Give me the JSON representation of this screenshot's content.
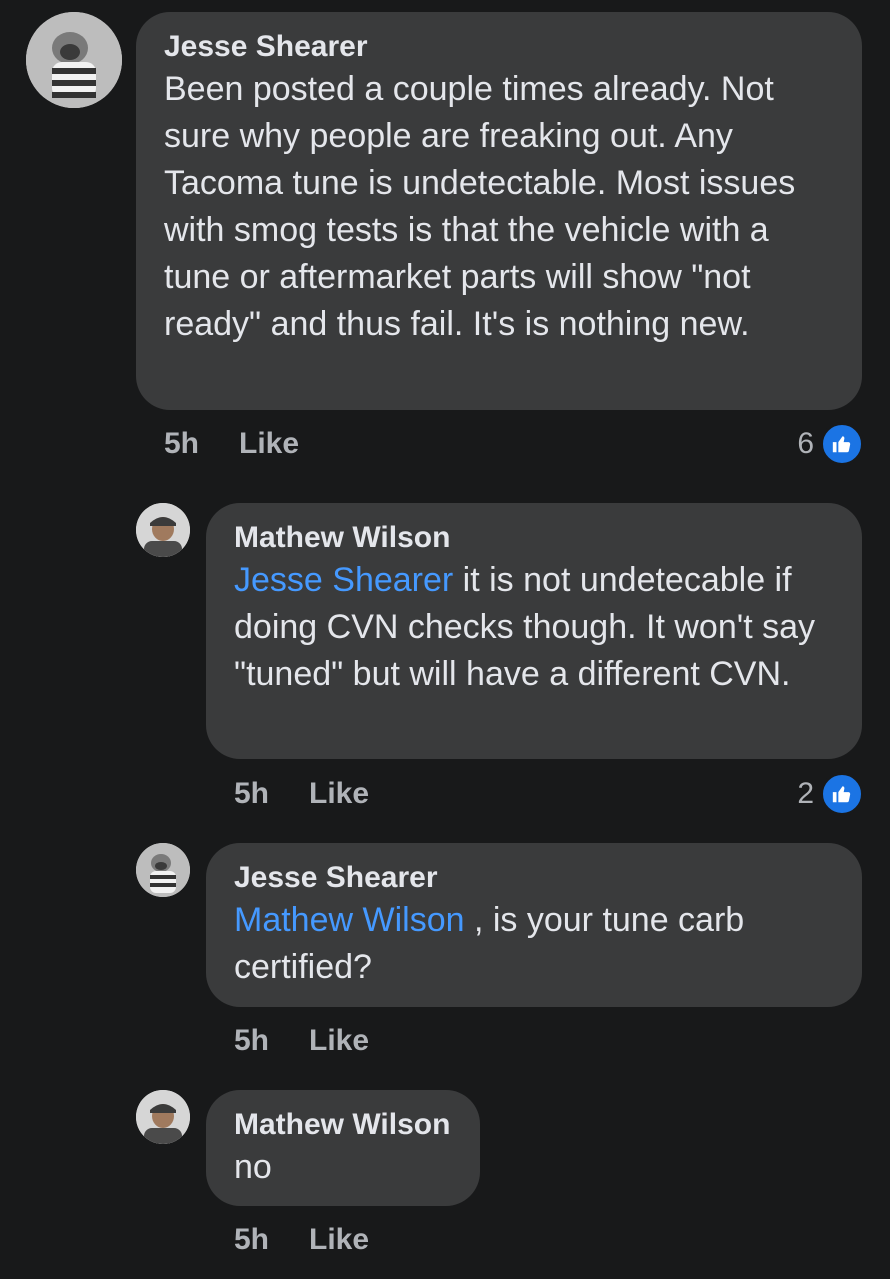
{
  "comments": [
    {
      "author": "Jesse Shearer",
      "text": "Been posted a couple times already. Not sure why people are freaking out. Any Tacoma tune is undetectable. Most issues with smog tests is that the vehicle with a tune or aftermarket parts will show \"not ready\" and thus fail. It's is nothing new.",
      "time": "5h",
      "like_label": "Like",
      "reaction_count": "6"
    },
    {
      "author": "Mathew Wilson",
      "mention": "Jesse Shearer",
      "text": " it is not undetecable if doing CVN checks though. It won't say \"tuned\" but will have a different CVN.",
      "time": "5h",
      "like_label": "Like",
      "reaction_count": "2"
    },
    {
      "author": "Jesse Shearer",
      "mention": "Mathew Wilson",
      "text": " , is your tune carb certified?",
      "time": "5h",
      "like_label": "Like"
    },
    {
      "author": "Mathew Wilson",
      "text": "no",
      "time": "5h",
      "like_label": "Like"
    }
  ],
  "icons": {
    "avatar_jesse": "dog-in-striped-sweater-avatar",
    "avatar_mathew": "man-in-cap-avatar",
    "reaction": "thumbs-up-icon"
  },
  "colors": {
    "background": "#18191a",
    "bubble": "#3a3b3c",
    "mention": "#4599ff",
    "like_badge": "#1b74e4"
  }
}
